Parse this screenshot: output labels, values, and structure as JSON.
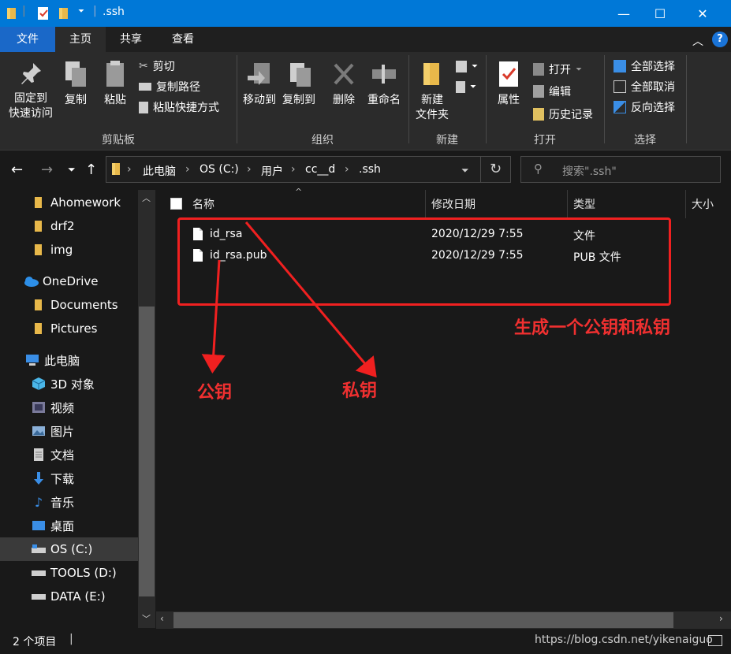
{
  "window": {
    "title": ".ssh",
    "controls": {
      "minimize": "—",
      "maximize": "☐",
      "close": "✕"
    }
  },
  "ribbon": {
    "tabs": [
      "文件",
      "主页",
      "共享",
      "查看"
    ],
    "clipboard": {
      "pin_line1": "固定到",
      "pin_line2": "快速访问",
      "copy": "复制",
      "paste": "粘贴",
      "cut": "剪切",
      "copy_path": "复制路径",
      "paste_shortcut": "粘贴快捷方式",
      "label": "剪贴板"
    },
    "organize": {
      "move_to": "移动到",
      "copy_to": "复制到",
      "delete": "删除",
      "rename": "重命名",
      "label": "组织"
    },
    "new": {
      "new_folder_line1": "新建",
      "new_folder_line2": "文件夹",
      "label": "新建"
    },
    "open": {
      "properties": "属性",
      "open": "打开",
      "edit": "编辑",
      "history": "历史记录",
      "label": "打开"
    },
    "select": {
      "select_all": "全部选择",
      "select_none": "全部取消",
      "invert": "反向选择",
      "label": "选择"
    },
    "help": "?"
  },
  "address": {
    "crumbs": [
      "此电脑",
      "OS (C:)",
      "用户",
      "cc__d",
      ".ssh"
    ],
    "search_placeholder": "搜索\".ssh\""
  },
  "sidebar": {
    "items": [
      {
        "label": "Ahomework",
        "icon": "folder-icon"
      },
      {
        "label": "drf2",
        "icon": "folder-icon"
      },
      {
        "label": "img",
        "icon": "folder-icon"
      },
      {
        "label": "OneDrive",
        "icon": "cloud-icon"
      },
      {
        "label": "Documents",
        "icon": "folder-icon"
      },
      {
        "label": "Pictures",
        "icon": "folder-icon"
      },
      {
        "label": "此电脑",
        "icon": "computer-icon"
      },
      {
        "label": "3D 对象",
        "icon": "cube-icon"
      },
      {
        "label": "视频",
        "icon": "video-icon"
      },
      {
        "label": "图片",
        "icon": "image-icon"
      },
      {
        "label": "文档",
        "icon": "document-icon"
      },
      {
        "label": "下载",
        "icon": "download-icon"
      },
      {
        "label": "音乐",
        "icon": "music-icon"
      },
      {
        "label": "桌面",
        "icon": "desktop-icon"
      },
      {
        "label": "OS (C:)",
        "icon": "drive-icon"
      },
      {
        "label": "TOOLS (D:)",
        "icon": "drive-icon"
      },
      {
        "label": "DATA (E:)",
        "icon": "drive-icon"
      }
    ]
  },
  "filelist": {
    "columns": [
      "名称",
      "修改日期",
      "类型",
      "大小"
    ],
    "rows": [
      {
        "name": "id_rsa",
        "date": "2020/12/29 7:55",
        "type": "文件"
      },
      {
        "name": "id_rsa.pub",
        "date": "2020/12/29 7:55",
        "type": "PUB 文件"
      }
    ]
  },
  "status": {
    "count": "2 个项目",
    "watermark": "https://blog.csdn.net/yikenaiguo"
  },
  "annotations": {
    "box_label": "生成一个公钥和私钥",
    "public_key": "公钥",
    "private_key": "私钥",
    "color": "#f02020"
  },
  "colors": {
    "titlebar": "#0078d7",
    "file_tab": "#1a68c8",
    "background": "#191919",
    "ribbon": "#2b2b2b"
  }
}
